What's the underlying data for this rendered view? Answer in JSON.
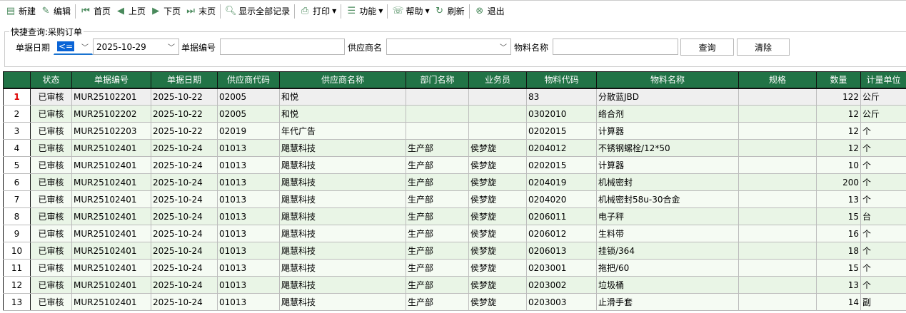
{
  "toolbar": [
    {
      "label": "新建",
      "icon": "document-icon"
    },
    {
      "label": "编辑",
      "icon": "edit-icon"
    },
    {
      "label": "首页",
      "icon": "first-page-icon"
    },
    {
      "label": "上页",
      "icon": "prev-page-icon"
    },
    {
      "label": "下页",
      "icon": "next-page-icon"
    },
    {
      "label": "末页",
      "icon": "last-page-icon"
    },
    {
      "label": "显示全部记录",
      "icon": "search-doc-icon"
    },
    {
      "label": "打印",
      "icon": "printer-icon"
    },
    {
      "label": "功能",
      "icon": "list-icon"
    },
    {
      "label": "帮助",
      "icon": "help-icon"
    },
    {
      "label": "刷新",
      "icon": "refresh-icon"
    },
    {
      "label": "退出",
      "icon": "exit-icon"
    }
  ],
  "query": {
    "legend": "快捷查询:采购订单",
    "date_label": "单据日期",
    "operator": "<=",
    "date_value": "2025-10-29",
    "billno_label": "单据编号",
    "billno_value": "",
    "supplier_label": "供应商名",
    "supplier_value": "",
    "material_label": "物料名称",
    "material_value": "",
    "query_button": "查询",
    "clear_button": "清除"
  },
  "table": {
    "headers": [
      "",
      "状态",
      "单据编号",
      "单据日期",
      "供应商代码",
      "供应商名称",
      "部门名称",
      "业务员",
      "物料代码",
      "物料名称",
      "规格",
      "数量",
      "计量单位"
    ],
    "rows": [
      [
        "1",
        "已审核",
        "MUR25102201",
        "2025-10-22",
        "02005",
        "和悦",
        "",
        "",
        "83",
        "分散蓝JBD",
        "",
        "122",
        "公斤"
      ],
      [
        "2",
        "已审核",
        "MUR25102202",
        "2025-10-22",
        "02005",
        "和悦",
        "",
        "",
        "0302010",
        "络合剂",
        "",
        "12",
        "公斤"
      ],
      [
        "3",
        "已审核",
        "MUR25102203",
        "2025-10-22",
        "02019",
        "年代广告",
        "",
        "",
        "0202015",
        "计算器",
        "",
        "12",
        "个"
      ],
      [
        "4",
        "已审核",
        "MUR25102401",
        "2025-10-24",
        "01013",
        "飓慧科技",
        "生产部",
        "侯梦旋",
        "0204012",
        "不锈钢螺栓/12*50",
        "",
        "12",
        "个"
      ],
      [
        "5",
        "已审核",
        "MUR25102401",
        "2025-10-24",
        "01013",
        "飓慧科技",
        "生产部",
        "侯梦旋",
        "0202015",
        "计算器",
        "",
        "10",
        "个"
      ],
      [
        "6",
        "已审核",
        "MUR25102401",
        "2025-10-24",
        "01013",
        "飓慧科技",
        "生产部",
        "侯梦旋",
        "0204019",
        "机械密封",
        "",
        "200",
        "个"
      ],
      [
        "7",
        "已审核",
        "MUR25102401",
        "2025-10-24",
        "01013",
        "飓慧科技",
        "生产部",
        "侯梦旋",
        "0204020",
        "机械密封58u-30合金",
        "",
        "13",
        "个"
      ],
      [
        "8",
        "已审核",
        "MUR25102401",
        "2025-10-24",
        "01013",
        "飓慧科技",
        "生产部",
        "侯梦旋",
        "0206011",
        "电子秤",
        "",
        "15",
        "台"
      ],
      [
        "9",
        "已审核",
        "MUR25102401",
        "2025-10-24",
        "01013",
        "飓慧科技",
        "生产部",
        "侯梦旋",
        "0206012",
        "生料带",
        "",
        "16",
        "个"
      ],
      [
        "10",
        "已审核",
        "MUR25102401",
        "2025-10-24",
        "01013",
        "飓慧科技",
        "生产部",
        "侯梦旋",
        "0206013",
        "挂锁/364",
        "",
        "18",
        "个"
      ],
      [
        "11",
        "已审核",
        "MUR25102401",
        "2025-10-24",
        "01013",
        "飓慧科技",
        "生产部",
        "侯梦旋",
        "0203001",
        "拖把/60",
        "",
        "15",
        "个"
      ],
      [
        "12",
        "已审核",
        "MUR25102401",
        "2025-10-24",
        "01013",
        "飓慧科技",
        "生产部",
        "侯梦旋",
        "0203002",
        "垃圾桶",
        "",
        "13",
        "个"
      ],
      [
        "13",
        "已审核",
        "MUR25102401",
        "2025-10-24",
        "01013",
        "飓慧科技",
        "生产部",
        "侯梦旋",
        "0203003",
        "止滑手套",
        "",
        "14",
        "副"
      ]
    ]
  },
  "colors": {
    "header_bg": "#217346",
    "row_alt": "#e9f5e6",
    "selected_row": "#efefef"
  }
}
